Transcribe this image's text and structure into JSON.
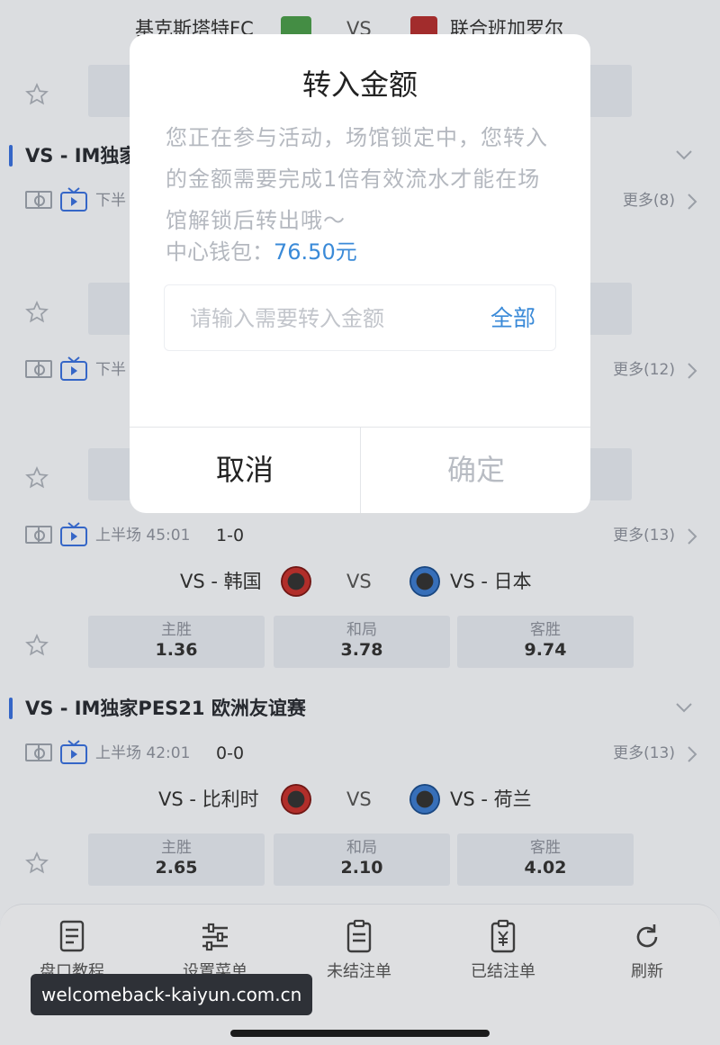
{
  "top_match": {
    "home": "基克斯塔特FC",
    "vs": "VS",
    "away": "联合班加罗尔"
  },
  "leagues": [
    {
      "name": "VS - IM独家"
    },
    {
      "name": "VS - IM独家PES21 欧洲友谊赛"
    }
  ],
  "matches": [
    {
      "period": "下半",
      "score": "",
      "more": "更多(8)"
    },
    {
      "period": "下半",
      "score": "",
      "more": "更多(12)"
    },
    {
      "period": "上半场 45:01",
      "score": "1-0",
      "more": "更多(13)",
      "home": "VS - 韩国",
      "vs": "VS",
      "away": "VS - 日本",
      "odds": [
        {
          "label": "主胜",
          "value": "1.36"
        },
        {
          "label": "和局",
          "value": "3.78"
        },
        {
          "label": "客胜",
          "value": "9.74"
        }
      ]
    },
    {
      "period": "上半场 42:01",
      "score": "0-0",
      "more": "更多(13)",
      "home": "VS - 比利时",
      "vs": "VS",
      "away": "VS - 荷兰",
      "odds": [
        {
          "label": "主胜",
          "value": "2.65"
        },
        {
          "label": "和局",
          "value": "2.10"
        },
        {
          "label": "客胜",
          "value": "4.02"
        }
      ]
    }
  ],
  "modal": {
    "title": "转入金额",
    "description": "您正在参与活动，场馆锁定中，您转入的金额需要完成1倍有效流水才能在场馆解锁后转出哦～",
    "wallet_label": "中心钱包：",
    "wallet_value": "76.50元",
    "input_placeholder": "请输入需要转入金额",
    "all_label": "全部",
    "cancel_label": "取消",
    "confirm_label": "确定"
  },
  "bottom_tabs": [
    {
      "label": "盘口教程",
      "icon": "guide-doc-icon"
    },
    {
      "label": "设置菜单",
      "icon": "settings-sliders-icon"
    },
    {
      "label": "未结注单",
      "icon": "clipboard-icon"
    },
    {
      "label": "已结注单",
      "icon": "yuan-clipboard-icon"
    },
    {
      "label": "刷新",
      "icon": "refresh-icon"
    }
  ],
  "watermark": "welcomeback-kaiyun.com.cn",
  "colors": {
    "accent": "#3a8ad8",
    "league_bar": "#3a6fd8",
    "background": "#eef0f3"
  }
}
